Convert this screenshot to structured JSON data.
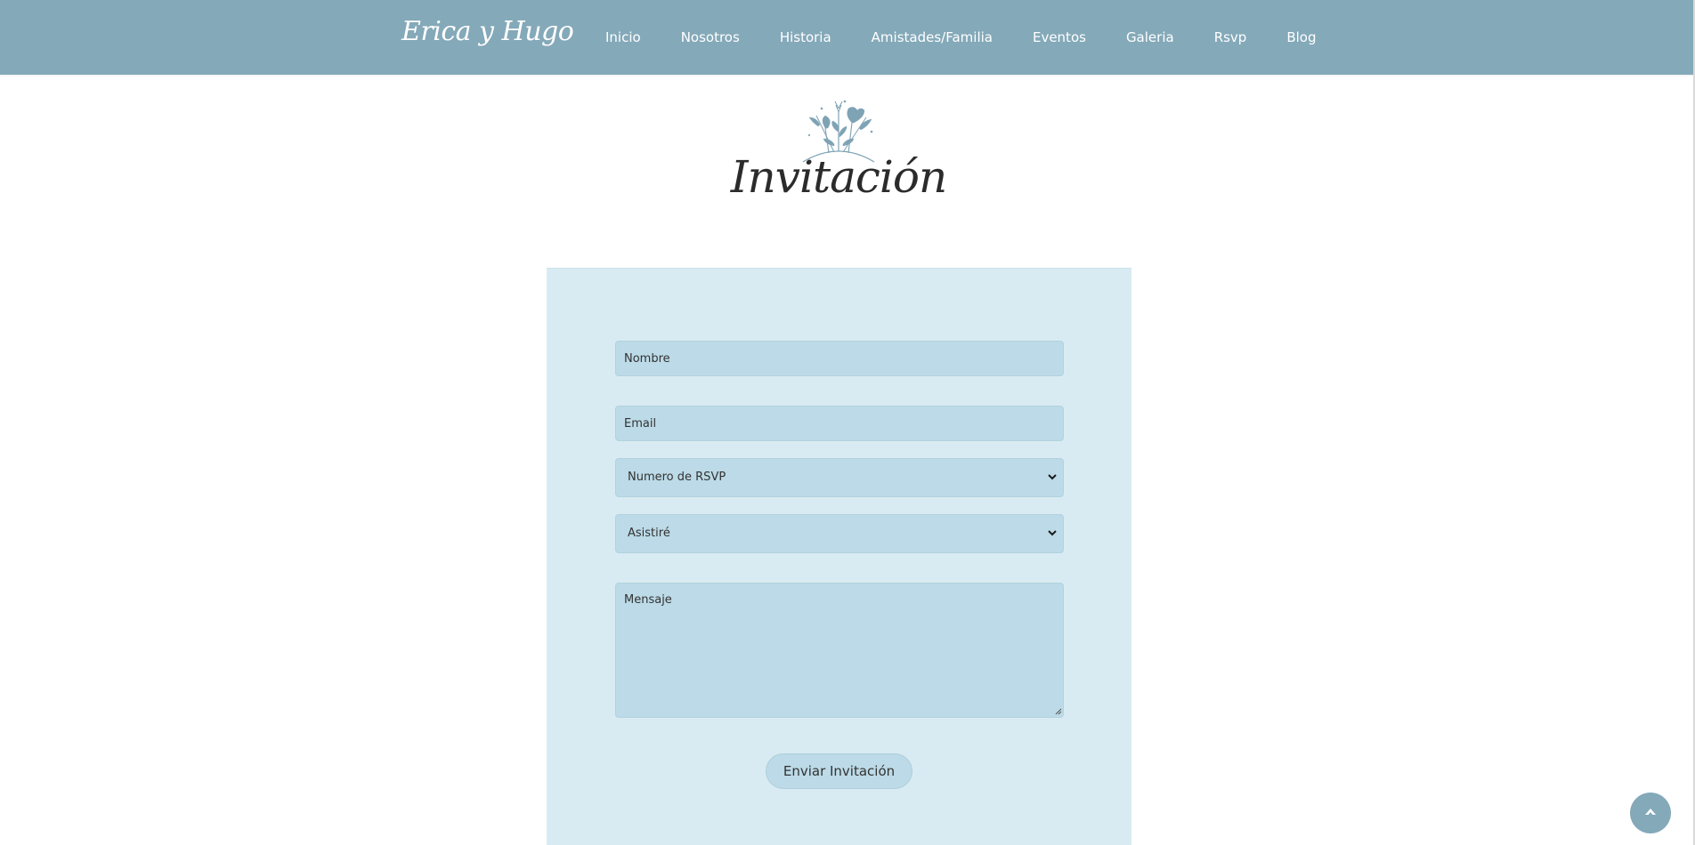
{
  "header": {
    "brand": "Erica y Hugo",
    "nav": [
      "Inicio",
      "Nosotros",
      "Historia",
      "Amistades/Familia",
      "Eventos",
      "Galeria",
      "Rsvp",
      "Blog"
    ]
  },
  "section": {
    "title": "Invitación",
    "ornament_icon": "floral-ornament-icon"
  },
  "form": {
    "name_placeholder": "Nombre",
    "email_placeholder": "Email",
    "rsvp_select_value": "Numero de RSVP",
    "attend_select_value": "Asistiré",
    "message_placeholder": "Mensaje",
    "submit_label": "Enviar Invitación"
  },
  "colors": {
    "header_bg": "#84a9b9",
    "panel_bg": "#d9ebf2",
    "field_bg": "#bcdae7"
  },
  "scroll_top_icon": "arrow-up-icon"
}
